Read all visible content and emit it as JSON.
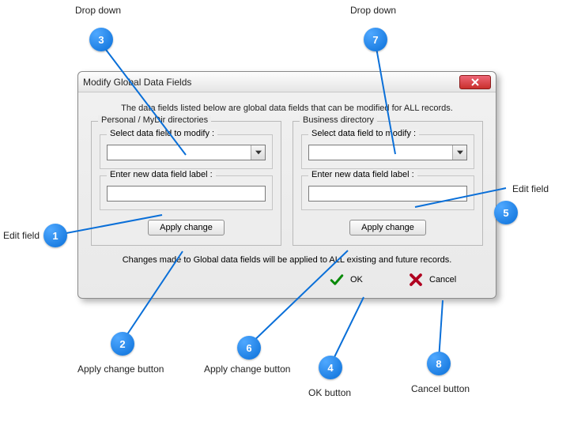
{
  "dialog": {
    "title": "Modify Global Data Fields",
    "intro": "The data fields listed below are global data fields that can be modified for ALL records.",
    "note": "Changes made to Global data fields will be applied to ALL existing and future records."
  },
  "personal": {
    "legend": "Personal / MyDir directories",
    "select_legend": "Select data field to modify :",
    "select_value": "",
    "enter_legend": "Enter new data field label :",
    "enter_value": "",
    "apply_label": "Apply change"
  },
  "business": {
    "legend": "Business directory",
    "select_legend": "Select data field to modify :",
    "select_value": "",
    "enter_legend": "Enter new data field label :",
    "enter_value": "",
    "apply_label": "Apply change"
  },
  "footer": {
    "ok_label": "OK",
    "cancel_label": "Cancel"
  },
  "callouts": {
    "1": "Edit field",
    "2": "Apply change button",
    "3": "Drop down",
    "4": "OK button",
    "5": "Edit field",
    "6": "Apply change button",
    "7": "Drop down",
    "8": "Cancel button"
  }
}
